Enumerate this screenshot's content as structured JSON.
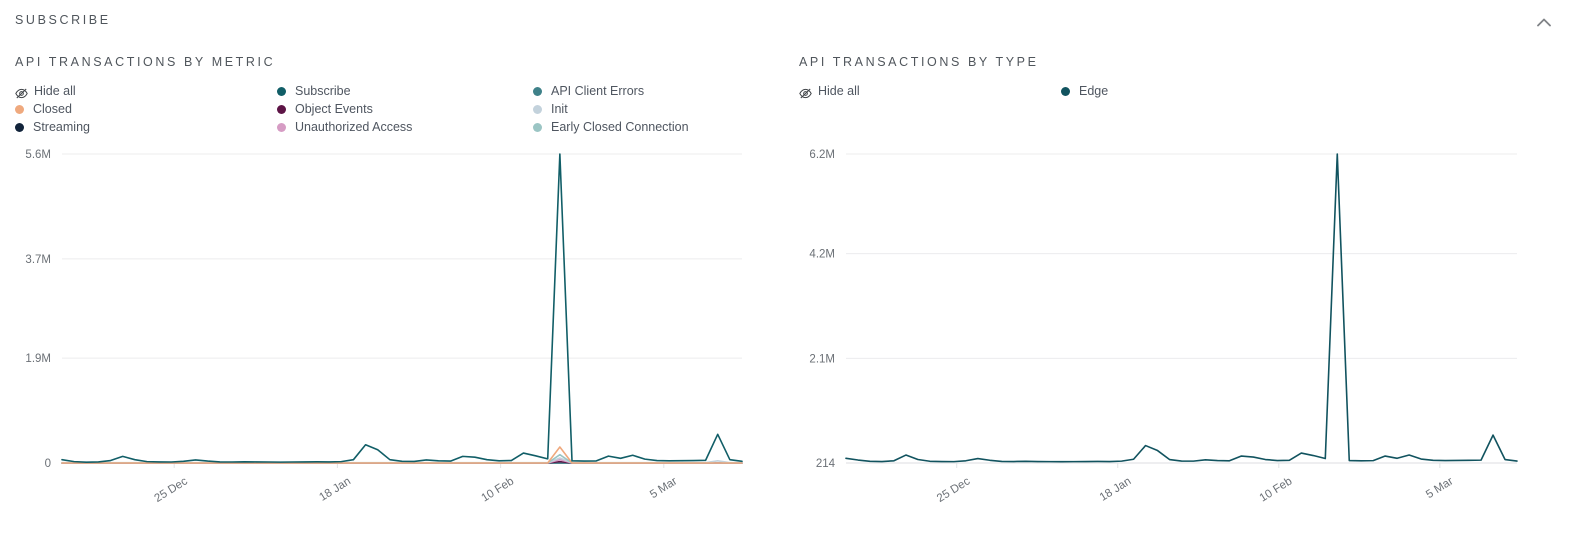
{
  "header": {
    "title": "SUBSCRIBE",
    "collapse_icon": "chevron-up-icon"
  },
  "charts": [
    {
      "title": "API TRANSACTIONS BY METRIC",
      "hide_all_label": "Hide all",
      "hide_all_icon": "eye-slash-icon",
      "legend_columns": [
        [
          {
            "label": "Closed",
            "color": "#efa97e"
          },
          {
            "label": "Streaming",
            "color": "#12243b"
          }
        ],
        [
          {
            "label": "Subscribe",
            "color": "#115e67"
          },
          {
            "label": "Object Events",
            "color": "#5d1446"
          },
          {
            "label": "Unauthorized Access",
            "color": "#d69cc4"
          }
        ],
        [
          {
            "label": "API Client Errors",
            "color": "#3f8189"
          },
          {
            "label": "Init",
            "color": "#c3d2dc"
          },
          {
            "label": "Early Closed Connection",
            "color": "#9bc5c4"
          }
        ]
      ]
    },
    {
      "title": "API TRANSACTIONS BY TYPE",
      "hide_all_label": "Hide all",
      "hide_all_icon": "eye-slash-icon",
      "legend_columns": [
        [],
        [
          {
            "label": "Edge",
            "color": "#11535f"
          }
        ],
        []
      ]
    }
  ],
  "chart_data": [
    {
      "type": "line",
      "title": "API TRANSACTIONS BY METRIC",
      "xlabel": "",
      "ylabel": "",
      "grid": true,
      "legend_position": "top",
      "yticks": [
        "0",
        "1.9M",
        "3.7M",
        "5.6M"
      ],
      "ytick_values": [
        0,
        1900000,
        3700000,
        5600000
      ],
      "ylim": [
        0,
        5600000
      ],
      "xticks": [
        "25 Dec",
        "18 Jan",
        "10 Feb",
        "5 Mar"
      ],
      "xtick_positions": [
        0.165,
        0.405,
        0.645,
        0.885
      ],
      "series": [
        {
          "name": "Subscribe",
          "color": "#115e67",
          "values": [
            60000,
            25000,
            15000,
            20000,
            45000,
            120000,
            60000,
            25000,
            20000,
            18000,
            30000,
            55000,
            35000,
            20000,
            18000,
            22000,
            20000,
            18000,
            16000,
            18000,
            20000,
            22000,
            20000,
            25000,
            60000,
            330000,
            240000,
            60000,
            30000,
            28000,
            55000,
            40000,
            35000,
            120000,
            105000,
            60000,
            40000,
            45000,
            180000,
            130000,
            75000,
            5600000,
            40000,
            35000,
            38000,
            125000,
            85000,
            140000,
            70000,
            45000,
            40000,
            42000,
            45000,
            48000,
            520000,
            60000,
            30000
          ]
        },
        {
          "name": "Closed",
          "color": "#efa97e",
          "values": [
            0,
            0,
            0,
            0,
            0,
            0,
            0,
            0,
            0,
            0,
            0,
            0,
            0,
            0,
            0,
            0,
            0,
            0,
            0,
            0,
            0,
            0,
            0,
            0,
            0,
            0,
            0,
            0,
            0,
            0,
            0,
            0,
            0,
            0,
            0,
            0,
            0,
            0,
            0,
            0,
            0,
            290000,
            0,
            0,
            0,
            0,
            0,
            0,
            0,
            0,
            0,
            0,
            0,
            0,
            0,
            0,
            0
          ]
        },
        {
          "name": "Early Closed Connection",
          "color": "#9bc5c4",
          "values": [
            0,
            0,
            0,
            0,
            0,
            0,
            0,
            0,
            0,
            0,
            0,
            0,
            0,
            0,
            0,
            0,
            0,
            0,
            0,
            0,
            0,
            0,
            0,
            0,
            0,
            0,
            0,
            0,
            0,
            0,
            0,
            0,
            0,
            0,
            0,
            0,
            0,
            0,
            0,
            0,
            0,
            150000,
            0,
            0,
            0,
            0,
            0,
            0,
            0,
            0,
            0,
            0,
            0,
            0,
            0,
            0,
            0
          ]
        },
        {
          "name": "Unauthorized Access",
          "color": "#d69cc4",
          "values": [
            0,
            0,
            0,
            0,
            0,
            0,
            0,
            0,
            0,
            0,
            0,
            0,
            0,
            0,
            0,
            0,
            0,
            0,
            0,
            0,
            0,
            0,
            0,
            0,
            0,
            0,
            0,
            0,
            0,
            0,
            0,
            0,
            0,
            0,
            0,
            0,
            0,
            0,
            0,
            0,
            0,
            60000,
            0,
            0,
            0,
            0,
            0,
            0,
            0,
            0,
            0,
            0,
            0,
            0,
            0,
            0,
            0
          ]
        },
        {
          "name": "Init",
          "color": "#c3d2dc",
          "values": [
            5000,
            5000,
            5000,
            5000,
            5000,
            5000,
            5000,
            5000,
            5000,
            5000,
            5000,
            5000,
            5000,
            5000,
            5000,
            5000,
            5000,
            5000,
            5000,
            5000,
            5000,
            5000,
            5000,
            5000,
            5000,
            5000,
            5000,
            5000,
            5000,
            5000,
            5000,
            5000,
            5000,
            5000,
            5000,
            5000,
            5000,
            5000,
            5000,
            5000,
            5000,
            90000,
            5000,
            5000,
            5000,
            5000,
            5000,
            5000,
            5000,
            5000,
            5000,
            5000,
            5000,
            5000,
            40000,
            5000,
            5000
          ]
        },
        {
          "name": "API Client Errors",
          "color": "#3f8189",
          "values": [
            2000,
            2000,
            2000,
            2000,
            2000,
            2000,
            2000,
            2000,
            2000,
            2000,
            2000,
            2000,
            2000,
            2000,
            2000,
            2000,
            2000,
            2000,
            2000,
            2000,
            2000,
            2000,
            2000,
            2000,
            2000,
            2000,
            2000,
            2000,
            2000,
            2000,
            2000,
            2000,
            2000,
            2000,
            2000,
            2000,
            2000,
            2000,
            2000,
            2000,
            2000,
            2000,
            2000,
            2000,
            2000,
            2000,
            2000,
            2000,
            2000,
            2000,
            2000,
            2000,
            2000,
            2000,
            2000,
            2000,
            2000
          ]
        },
        {
          "name": "Object Events",
          "color": "#5d1446",
          "values": [
            0,
            0,
            0,
            0,
            0,
            0,
            0,
            0,
            0,
            0,
            0,
            0,
            0,
            0,
            0,
            0,
            0,
            0,
            0,
            0,
            0,
            0,
            0,
            0,
            0,
            0,
            0,
            0,
            0,
            0,
            0,
            0,
            0,
            0,
            0,
            0,
            0,
            0,
            0,
            0,
            0,
            25000,
            0,
            0,
            0,
            0,
            0,
            0,
            0,
            0,
            0,
            0,
            0,
            0,
            0,
            0,
            0
          ]
        },
        {
          "name": "Streaming",
          "color": "#12243b",
          "values": [
            0,
            0,
            0,
            0,
            0,
            0,
            0,
            0,
            0,
            0,
            0,
            0,
            0,
            0,
            0,
            0,
            0,
            0,
            0,
            0,
            0,
            0,
            0,
            0,
            0,
            0,
            0,
            0,
            0,
            0,
            0,
            0,
            0,
            0,
            0,
            0,
            0,
            0,
            0,
            0,
            0,
            0,
            0,
            0,
            0,
            0,
            0,
            0,
            0,
            0,
            0,
            0,
            0,
            0,
            0,
            0,
            0
          ]
        }
      ]
    },
    {
      "type": "line",
      "title": "API TRANSACTIONS BY TYPE",
      "xlabel": "",
      "ylabel": "",
      "grid": true,
      "legend_position": "top",
      "yticks": [
        "214",
        "2.1M",
        "4.2M",
        "6.2M"
      ],
      "ytick_values": [
        214,
        2100000,
        4200000,
        6200000
      ],
      "ylim": [
        214,
        6200000
      ],
      "xticks": [
        "25 Dec",
        "18 Jan",
        "10 Feb",
        "5 Mar"
      ],
      "xtick_positions": [
        0.165,
        0.405,
        0.645,
        0.885
      ],
      "series": [
        {
          "name": "Edge",
          "color": "#11535f",
          "values": [
            95000,
            60000,
            35000,
            30000,
            45000,
            160000,
            70000,
            35000,
            30000,
            28000,
            45000,
            90000,
            55000,
            32000,
            30000,
            35000,
            30000,
            28000,
            26000,
            28000,
            30000,
            32000,
            30000,
            38000,
            75000,
            350000,
            250000,
            70000,
            40000,
            38000,
            65000,
            50000,
            45000,
            140000,
            120000,
            70000,
            50000,
            55000,
            200000,
            150000,
            90000,
            6200000,
            50000,
            45000,
            48000,
            140000,
            95000,
            160000,
            80000,
            55000,
            50000,
            52000,
            55000,
            58000,
            560000,
            70000,
            40000
          ]
        }
      ]
    }
  ]
}
